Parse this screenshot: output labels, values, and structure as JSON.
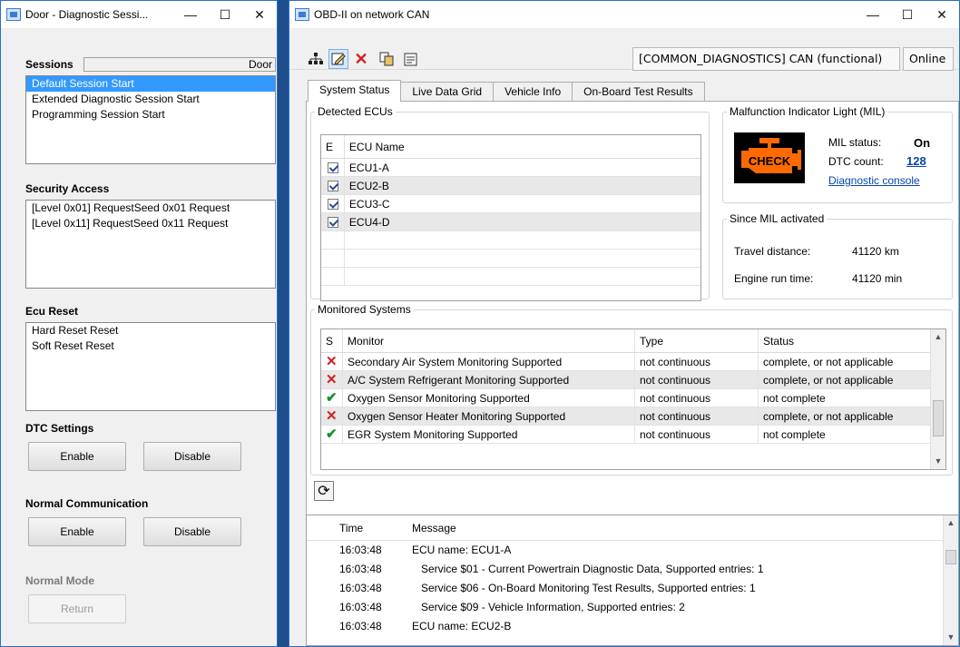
{
  "left_window": {
    "title": "Door - Diagnostic Sessi...",
    "controls": {
      "minimize": "—",
      "maximize": "☐",
      "close": "✕"
    },
    "sessions": {
      "heading": "Sessions",
      "context": "Door",
      "items": [
        "Default Session Start",
        "Extended Diagnostic Session Start",
        "Programming Session Start"
      ],
      "selected_index": 0
    },
    "security_access": {
      "heading": "Security Access",
      "items": [
        "[Level 0x01] RequestSeed 0x01 Request",
        "[Level 0x11] RequestSeed 0x11 Request"
      ]
    },
    "ecu_reset": {
      "heading": "Ecu Reset",
      "items": [
        "Hard Reset Reset",
        "Soft Reset Reset"
      ]
    },
    "dtc_settings": {
      "heading": "DTC Settings",
      "enable": "Enable",
      "disable": "Disable"
    },
    "normal_communication": {
      "heading": "Normal Communication",
      "enable": "Enable",
      "disable": "Disable"
    },
    "normal_mode": {
      "heading": "Normal Mode",
      "return": "Return"
    }
  },
  "right_window": {
    "title": "OBD-II on network CAN",
    "controls": {
      "minimize": "—",
      "maximize": "☐",
      "close": "✕"
    },
    "toolbar": {
      "icons": [
        "network-icon",
        "edit-icon",
        "delete-icon",
        "copy-icon",
        "notes-icon"
      ],
      "network_field": "[COMMON_DIAGNOSTICS] CAN (functional)",
      "status_field": "Online"
    },
    "tabs": [
      "System Status",
      "Live Data Grid",
      "Vehicle Info",
      "On-Board Test Results"
    ],
    "active_tab": 0,
    "detected_ecus": {
      "legend": "Detected ECUs",
      "columns": [
        "E",
        "ECU Name"
      ],
      "rows": [
        {
          "enabled": true,
          "name": "ECU1-A"
        },
        {
          "enabled": true,
          "name": "ECU2-B"
        },
        {
          "enabled": true,
          "name": "ECU3-C"
        },
        {
          "enabled": true,
          "name": "ECU4-D"
        }
      ]
    },
    "mil": {
      "legend": "Malfunction Indicator Light (MIL)",
      "icon_label": "CHECK",
      "status_label": "MIL status:",
      "status_value": "On",
      "dtc_label": "DTC count:",
      "dtc_value": "128",
      "console_link": "Diagnostic console",
      "color_amber": "#ff6a00"
    },
    "since_mil": {
      "legend": "Since MIL activated",
      "travel_label": "Travel distance:",
      "travel_value": "41120 km",
      "runtime_label": "Engine run time:",
      "runtime_value": "41120 min"
    },
    "monitored_systems": {
      "legend": "Monitored Systems",
      "columns": [
        "S",
        "Monitor",
        "Type",
        "Status"
      ],
      "rows": [
        {
          "ok": false,
          "monitor": "Secondary Air System Monitoring Supported",
          "type": "not continuous",
          "status": "complete, or not applicable"
        },
        {
          "ok": false,
          "monitor": "A/C System Refrigerant Monitoring Supported",
          "type": "not continuous",
          "status": "complete, or not applicable"
        },
        {
          "ok": true,
          "monitor": "Oxygen Sensor Monitoring Supported",
          "type": "not continuous",
          "status": "not complete"
        },
        {
          "ok": false,
          "monitor": "Oxygen Sensor Heater Monitoring Supported",
          "type": "not continuous",
          "status": "complete, or not applicable"
        },
        {
          "ok": true,
          "monitor": "EGR System Monitoring Supported",
          "type": "not continuous",
          "status": "not complete"
        }
      ]
    },
    "refresh_icon": "refresh-icon",
    "log": {
      "columns": [
        "Time",
        "Message"
      ],
      "rows": [
        {
          "time": "16:03:48",
          "message": "ECU name: ECU1-A",
          "indent": false
        },
        {
          "time": "16:03:48",
          "message": "Service $01 - Current Powertrain Diagnostic Data, Supported entries: 1",
          "indent": true
        },
        {
          "time": "16:03:48",
          "message": "Service $06 - On-Board Monitoring Test Results, Supported entries: 1",
          "indent": true
        },
        {
          "time": "16:03:48",
          "message": "Service $09 - Vehicle Information, Supported entries: 2",
          "indent": true
        },
        {
          "time": "16:03:48",
          "message": "ECU name: ECU2-B",
          "indent": false
        }
      ]
    }
  }
}
